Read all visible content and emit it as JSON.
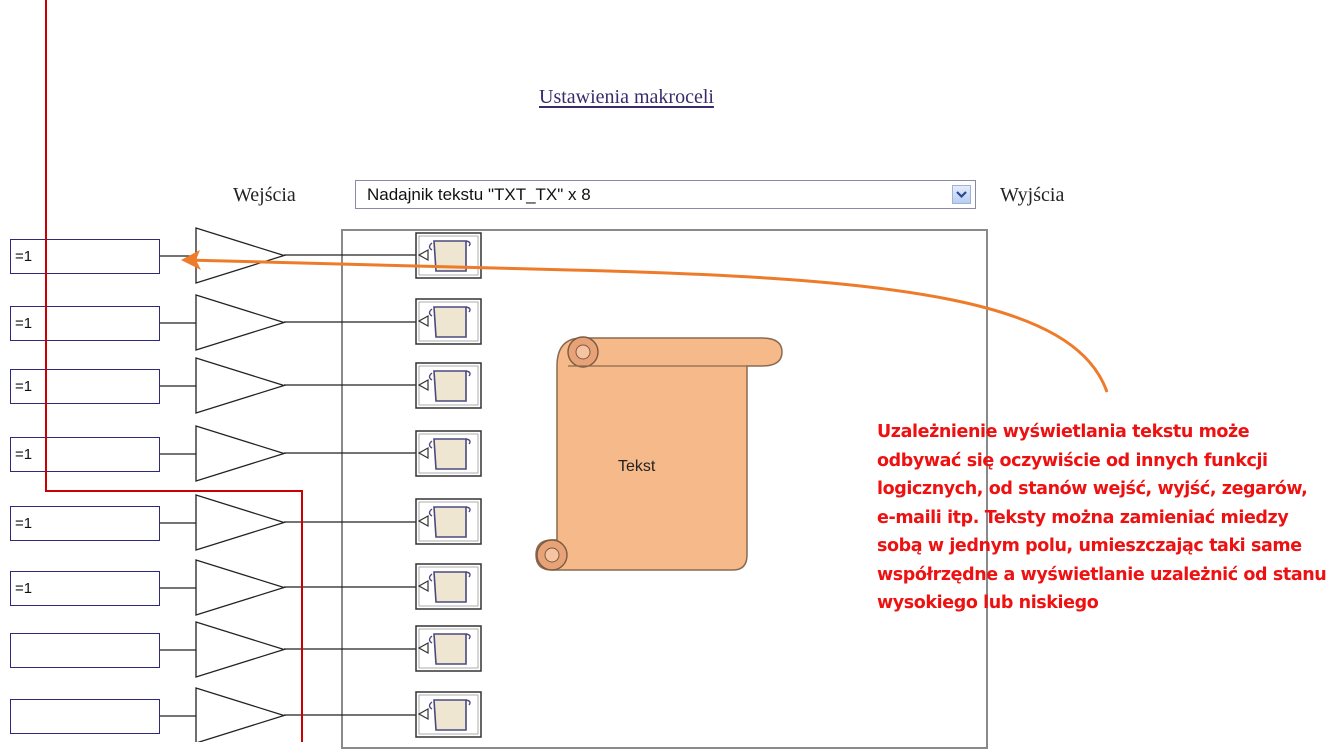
{
  "title": "Ustawienia makroceli",
  "inputs_label": "Wejścia",
  "outputs_label": "Wyjścia",
  "selector": {
    "value": "Nadajnik tekstu \"TXT_TX\" x 8"
  },
  "input_fields": [
    "=1",
    "=1",
    "=1",
    "=1",
    "=1",
    "=1",
    "",
    ""
  ],
  "preview_text": "Tekst",
  "annotation": "Uzależnienie wyświetlania tekstu może odbywać się oczywiście od innych funkcji logicznych, od stanów wejść, wyjść, zegarów, e-maili itp. Teksty można zamieniać miedzy sobą w jednym polu, umieszczając taki same współrzędne a wyświetlanie uzależnić od stanu wysokiego lub niskiego",
  "colors": {
    "annotation_text": "#ee1111",
    "red_line": "#cc0000",
    "orange_arrow": "#ee7b2a",
    "scroll_fill": "#f6b98a",
    "field_border": "#2e2a78"
  }
}
